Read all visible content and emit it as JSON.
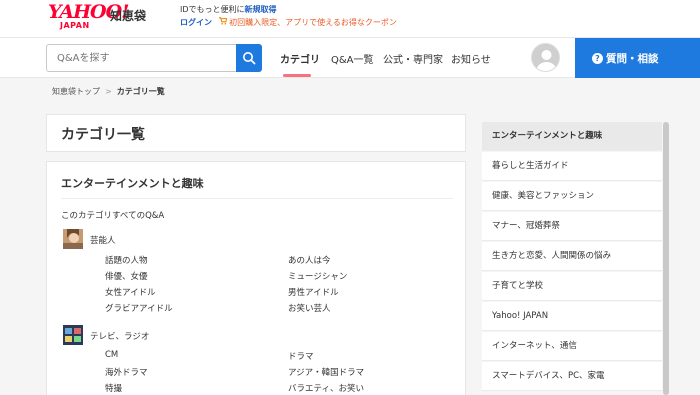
{
  "header": {
    "logo_text": "YAHOO!",
    "logo_sub": "JAPAN",
    "site_name": "知恵袋",
    "promo_line1_prefix": "IDでもっと便利に",
    "promo_line1_link": "新規取得",
    "login_label": "ログイン",
    "coupon_text": "初回購入限定、アプリで使えるお得なクーポン"
  },
  "nav": {
    "search_placeholder": "Q&Aを探す",
    "items": [
      {
        "label": "カテゴリ",
        "active": true
      },
      {
        "label": "Q&A一覧",
        "active": false
      },
      {
        "label": "公式・専門家",
        "active": false
      },
      {
        "label": "お知らせ",
        "active": false
      }
    ],
    "ask_label": "質問・相談"
  },
  "breadcrumb": {
    "home": "知恵袋トップ",
    "separator": ">",
    "current": "カテゴリ一覧"
  },
  "main": {
    "title": "カテゴリ一覧",
    "section_title": "エンターテインメントと趣味",
    "all_link": "このカテゴリすべてのQ&A",
    "groups": [
      {
        "label": "芸能人",
        "icon": "celebrity-photo-icon",
        "subs": [
          "話題の人物",
          "あの人は今",
          "俳優、女優",
          "ミュージシャン",
          "女性アイドル",
          "男性アイドル",
          "グラビアアイドル",
          "お笑い芸人"
        ]
      },
      {
        "label": "テレビ、ラジオ",
        "icon": "tv-photo-icon",
        "subs": [
          "CM",
          "ドラマ",
          "海外ドラマ",
          "アジア・韓国ドラマ",
          "特撮",
          "バラエティ、お笑い"
        ]
      }
    ]
  },
  "sidebar": {
    "items": [
      {
        "label": "エンターテインメントと趣味",
        "active": true
      },
      {
        "label": "暮らしと生活ガイド",
        "active": false
      },
      {
        "label": "健康、美容とファッション",
        "active": false
      },
      {
        "label": "マナー、冠婚葬祭",
        "active": false
      },
      {
        "label": "生き方と恋愛、人間関係の悩み",
        "active": false
      },
      {
        "label": "子育てと学校",
        "active": false
      },
      {
        "label": "Yahoo! JAPAN",
        "active": false
      },
      {
        "label": "インターネット、通信",
        "active": false
      },
      {
        "label": "スマートデバイス、PC、家電",
        "active": false
      }
    ]
  },
  "colors": {
    "brand_red": "#ff0033",
    "primary_blue": "#1f7ae0",
    "active_underline": "#f4737e"
  }
}
